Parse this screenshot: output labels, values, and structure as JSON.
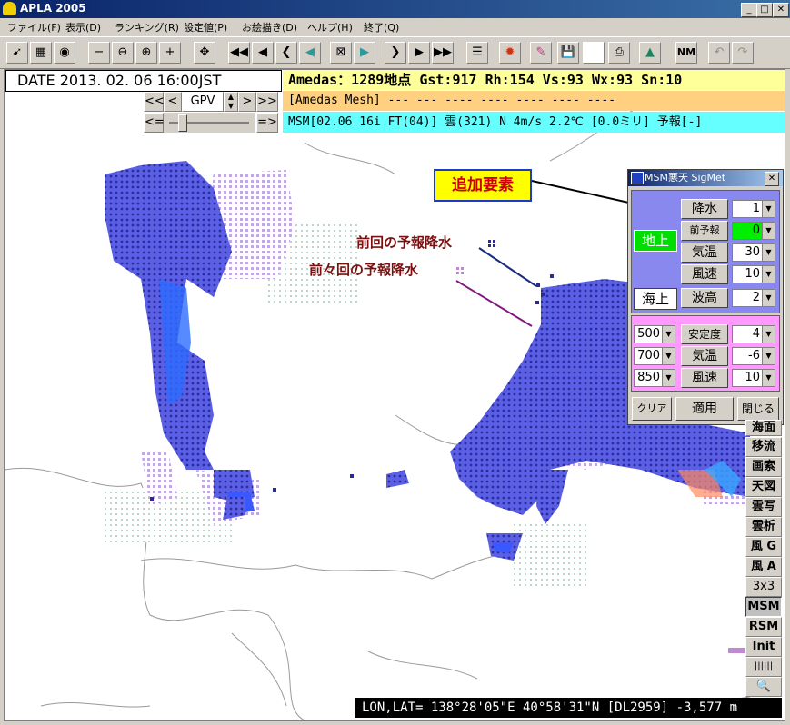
{
  "window": {
    "title": "APLA 2005"
  },
  "menu": [
    "ファイル(F)",
    "表示(D)",
    "ランキング(R)",
    "設定値(P)",
    "お絵描き(D)",
    "ヘルプ(H)",
    "終了(Q)"
  ],
  "info": {
    "date": "DATE 2013. 02. 06  16:00JST",
    "line1": "Amedas：1289地点  Gst:917 Rh:154 Vs:93 Wx:93 Sn:10",
    "line2": "[Amedas Mesh] ---  ---  ----  ----  ----  ----  ----",
    "line3": "MSM[02.06 16i FT(04)] 雲(321) N   4m/s 2.2℃ [0.0ミリ] 予報[-]"
  },
  "gpv": {
    "label": "GPV",
    "first": "<<",
    "prev": "<",
    "next": ">",
    "last": ">>",
    "left": "<=",
    "right": "=>"
  },
  "dialog": {
    "title": "MSM悪天 SigMet",
    "section_ground": "地上",
    "section_sea": "海上",
    "rain_label": "降水",
    "rain_value": "1",
    "prev_label": "前予報",
    "prev_value": "0",
    "temp_label": "気温",
    "temp_value": "30",
    "wind_label": "風速",
    "wind_value": "10",
    "wave_label": "波高",
    "wave_value": "2",
    "upper": [
      {
        "level": "500",
        "label": "安定度",
        "value": "4"
      },
      {
        "level": "700",
        "label": "気温",
        "value": "-6"
      },
      {
        "level": "850",
        "label": "風速",
        "value": "10"
      }
    ],
    "clear": "クリア",
    "apply": "適用",
    "close": "閉じる"
  },
  "side_buttons": [
    "海面",
    "移流",
    "画索",
    "天図",
    "雲写",
    "雲析",
    "風 G",
    "風 A",
    "3x3",
    "MSM",
    "RSM",
    "Init",
    "||||||"
  ],
  "status": "LON,LAT= 138°28'05\"E  40°58'31\"N [DL2959]  -3,577 m",
  "annotations": {
    "callout": "追加要素",
    "prev_forecast": "前回の予報降水",
    "prev_prev_forecast": "前々回の予報降水"
  },
  "colors": {
    "precip_main": "#5a5ee0",
    "precip_deep": "#2a5cff",
    "prev_forecast": "#3a3aa0",
    "prev_prev_forecast": "#b07ac8",
    "callout_bg": "#ffff00"
  }
}
